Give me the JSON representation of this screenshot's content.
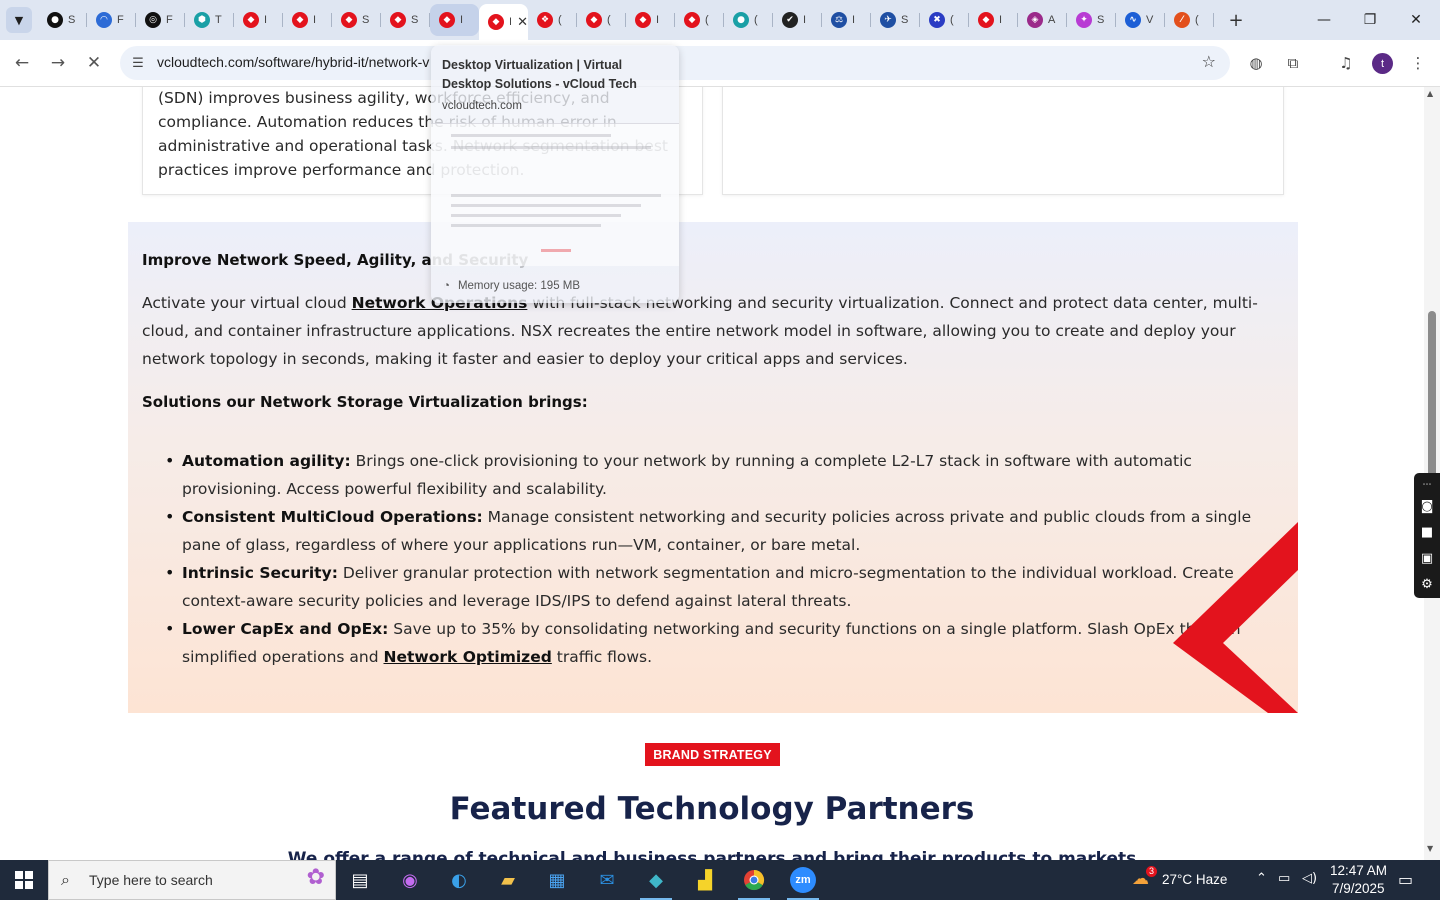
{
  "tabs": [
    {
      "icon": "github-icon",
      "label": "S",
      "color": "#111111",
      "glyph": "●"
    },
    {
      "icon": "arc-icon",
      "label": "F",
      "color": "#2d6bd6",
      "glyph": "◠"
    },
    {
      "icon": "openai-icon",
      "label": "F",
      "color": "#111111",
      "glyph": "◎"
    },
    {
      "icon": "teal-hex-icon",
      "label": "T",
      "color": "#1aa0a6",
      "glyph": "⬢"
    },
    {
      "icon": "vcloud-icon",
      "label": "I",
      "color": "#e3131d",
      "glyph": "◆"
    },
    {
      "icon": "vcloud-icon",
      "label": "I",
      "color": "#e3131d",
      "glyph": "◆"
    },
    {
      "icon": "vcloud-icon",
      "label": "S",
      "color": "#e3131d",
      "glyph": "◆"
    },
    {
      "icon": "vcloud-icon",
      "label": "S",
      "color": "#e3131d",
      "glyph": "◆"
    },
    {
      "icon": "vcloud-icon",
      "label": "I",
      "color": "#e3131d",
      "glyph": "◆",
      "state": "hover"
    },
    {
      "icon": "vcloud-icon",
      "label": "I",
      "color": "#e3131d",
      "glyph": "◆",
      "state": "active"
    },
    {
      "icon": "dots-icon",
      "label": "(",
      "color": "#e3131d",
      "glyph": "❖"
    },
    {
      "icon": "vcloud-icon",
      "label": "(",
      "color": "#e3131d",
      "glyph": "◆"
    },
    {
      "icon": "vcloud-icon",
      "label": "I",
      "color": "#e3131d",
      "glyph": "◆"
    },
    {
      "icon": "vcloud-icon",
      "label": "(",
      "color": "#e3131d",
      "glyph": "◆"
    },
    {
      "icon": "teal-circle-icon",
      "label": "(",
      "color": "#1aa0a6",
      "glyph": "●"
    },
    {
      "icon": "check-icon",
      "label": "I",
      "color": "#222222",
      "glyph": "✔"
    },
    {
      "icon": "scale-icon",
      "label": "I",
      "color": "#1f4fa3",
      "glyph": "⚖"
    },
    {
      "icon": "bird-icon",
      "label": "S",
      "color": "#1f4fa3",
      "glyph": "✈"
    },
    {
      "icon": "x-icon",
      "label": "(",
      "color": "#2a3cc4",
      "glyph": "✖"
    },
    {
      "icon": "vcloud-icon",
      "label": "I",
      "color": "#e3131d",
      "glyph": "◆"
    },
    {
      "icon": "diamond-pair-icon",
      "label": "A",
      "color": "#9b2a8a",
      "glyph": "◈"
    },
    {
      "icon": "spark-icon",
      "label": "S",
      "color": "#b83bd4",
      "glyph": "✦"
    },
    {
      "icon": "pulse-icon",
      "label": "V",
      "color": "#1d5fd6",
      "glyph": "∿"
    },
    {
      "icon": "slash-icon",
      "label": "(",
      "color": "#e3501d",
      "glyph": "⁄"
    }
  ],
  "address": {
    "url": "vcloudtech.com/software/hybrid-it/network-v"
  },
  "profile_initial": "t",
  "hovercard": {
    "title": "Desktop Virtualization | Virtual Desktop Solutions - vCloud Tech",
    "domain": "vcloudtech.com",
    "memory": "Memory usage: 195 MB"
  },
  "card_left_text": "(SDN) improves business agility, workforce efficiency, and compliance. Automation reduces the risk of human error in administrative and operational tasks. Network segmentation best practices improve performance and protection.",
  "section": {
    "title": "Improve Network Speed, Agility, and Security",
    "para_pre": " Activate your virtual cloud ",
    "para_link": "Network Operations",
    "para_post": " with full-stack networking and security virtualization. Connect and protect data center, multi-cloud, and container infrastructure applications. NSX recreates the entire network model in software, allowing you to create and deploy your network topology in seconds, making it faster and easier to deploy your critical apps and services.",
    "subtitle": "Solutions our Network Storage Virtualization brings:",
    "bullets": [
      {
        "term": "Automation agility:",
        "text": " Brings one-click provisioning to your network by running a complete L2-L7 stack in software with automatic provisioning. Access powerful flexibility and scalability."
      },
      {
        "term": "Consistent MultiCloud Operations:",
        "text": " Manage consistent networking and security policies across private and public clouds from a single pane of glass, regardless of where your applications run—VM, container, or bare metal."
      },
      {
        "term": "Intrinsic Security:",
        "text": " Deliver granular protection with network segmentation and micro-segmentation to the individual workload. Create context-aware security policies and leverage IDS/IPS to defend against lateral threats."
      },
      {
        "term": "Lower CapEx and OpEx:",
        "text": " Save up to 35% by consolidating networking and security functions on a single platform. Slash OpEx through simplified operations and ",
        "link": "Network Optimized",
        "tail": " traffic flows."
      }
    ]
  },
  "badge": "BRAND STRATEGY",
  "partners_heading": "Featured Technology Partners",
  "partners_sub": "We offer a range of technical and business partners and bring their products to markets",
  "taskbar": {
    "search_placeholder": "Type here to search",
    "weather": "27°C  Haze",
    "weather_badge": "3",
    "time": "12:47 AM",
    "date": "7/9/2025"
  },
  "colors": {
    "brand_red": "#e3131d",
    "heading_navy": "#17234a"
  }
}
